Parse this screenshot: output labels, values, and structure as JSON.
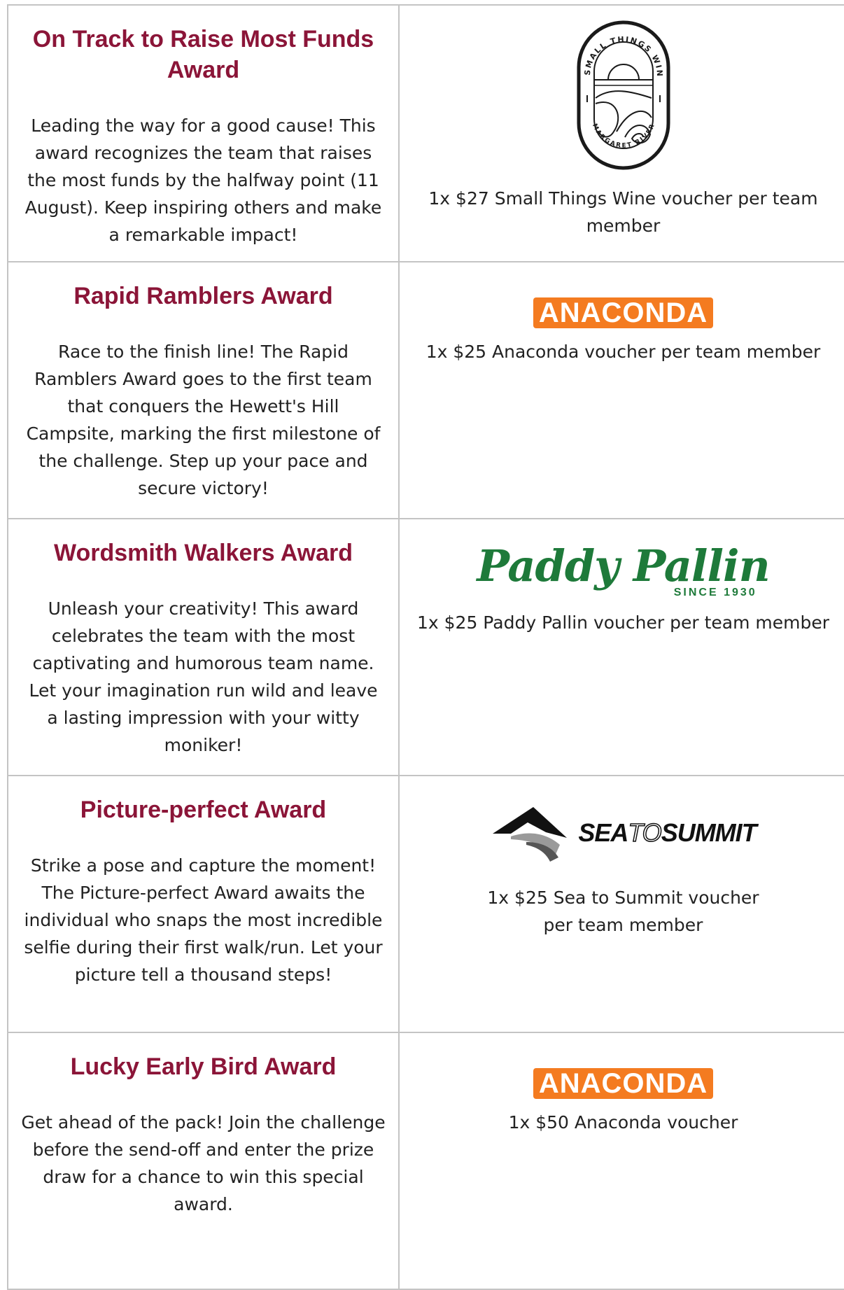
{
  "awards": [
    {
      "title": "On Track to Raise Most Funds Award",
      "description": "Leading the way for a good cause! This award recognizes the team that raises the most funds by the halfway point (11 August). Keep inspiring others and make a remarkable impact!",
      "logo": {
        "type": "small-things-wine",
        "top_text": "SMALL THINGS WINE",
        "bottom_text": "MARGARET RIVER"
      },
      "prize": "1x $27 Small Things Wine voucher per team member"
    },
    {
      "title": "Rapid Ramblers Award",
      "description": "Race to the finish line! The Rapid Ramblers Award goes to the first team that conquers the Hewett's Hill Campsite, marking the first milestone of the challenge. Step up your pace and secure victory!",
      "logo": {
        "type": "anaconda",
        "text": "ANACONDA",
        "color": "#f47b20"
      },
      "prize": "1x $25 Anaconda voucher per team member"
    },
    {
      "title": "Wordsmith Walkers Award",
      "description": "Unleash your creativity! This award celebrates the team with the most captivating and humorous team name. Let your imagination run wild and leave a lasting impression with your witty moniker!",
      "logo": {
        "type": "paddy-pallin",
        "text": "Paddy Pallin",
        "subtext": "SINCE 1930",
        "color": "#1e7a3a"
      },
      "prize": "1x $25 Paddy Pallin voucher per team member"
    },
    {
      "title": "Picture-perfect Award",
      "description": "Strike a pose and capture the moment! The Picture-perfect Award awaits the individual who snaps the most incredible selfie during their first walk/run. Let your picture tell a thousand steps!",
      "logo": {
        "type": "sea-to-summit",
        "text_a": "SEA",
        "text_b": "TO",
        "text_c": "SUMMIT"
      },
      "prize": "1x $25 Sea to Summit voucher per team member"
    },
    {
      "title": "Lucky Early Bird Award",
      "description": "Get ahead of the pack! Join the challenge before the send-off and enter the prize draw for a chance to win this special award.",
      "logo": {
        "type": "anaconda",
        "text": "ANACONDA",
        "color": "#f47b20"
      },
      "prize": "1x $50 Anaconda voucher"
    }
  ],
  "colors": {
    "title": "#8b1538",
    "border": "#c4c4c4",
    "text": "#222222"
  }
}
